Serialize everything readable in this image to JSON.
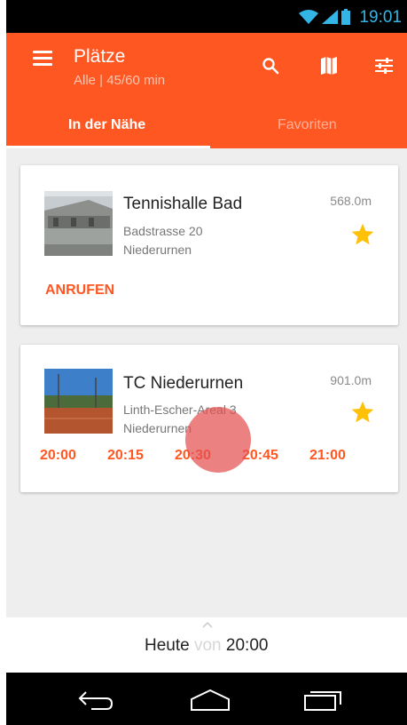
{
  "status": {
    "time": "19:01"
  },
  "appbar": {
    "title": "Plätze",
    "subtitle": "Alle | 45/60 min",
    "actions": [
      "search-icon",
      "map-icon",
      "tune-icon"
    ]
  },
  "tabs": [
    {
      "label": "In der Nähe",
      "active": true
    },
    {
      "label": "Favoriten",
      "active": false
    }
  ],
  "places": [
    {
      "name": "Tennishalle Bad",
      "street": "Badstrasse 20",
      "city": "Niederurnen",
      "distance": "568.0m",
      "favorite": true,
      "call_label": "ANRUFEN"
    },
    {
      "name": "TC Niederurnen",
      "street": "Linth-Escher-Areal 3",
      "city": "Niederurnen",
      "distance": "901.0m",
      "favorite": true,
      "slots": [
        "20:00",
        "20:15",
        "20:30",
        "20:45",
        "21:00"
      ]
    }
  ],
  "day_selector": {
    "day": "Heute",
    "von": "von",
    "time": "20:00"
  },
  "colors": {
    "primary": "#ff5722",
    "star": "#ffc107",
    "accent": "#33b5e5"
  }
}
